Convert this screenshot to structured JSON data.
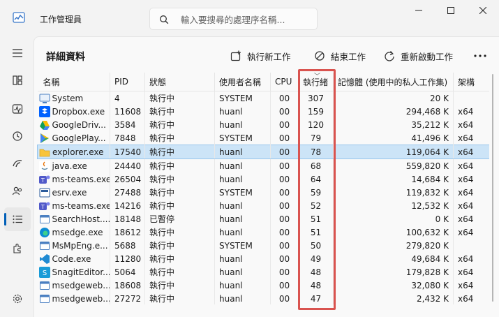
{
  "app": {
    "title": "工作管理員"
  },
  "search": {
    "placeholder": "輸入要搜尋的處理序名稱..."
  },
  "page": {
    "title": "詳細資料"
  },
  "commands": {
    "run_new_task": "執行新工作",
    "end_task": "結束工作",
    "restart": "重新啟動工作"
  },
  "accent_color": "#005fb8",
  "highlight_color": "#d9534f",
  "columns": [
    "名稱",
    "PID",
    "狀態",
    "使用者名稱",
    "CPU",
    "執行緒",
    "記憶體 (使用中的私人工作集)",
    "架構"
  ],
  "sorted_column": "執行緒",
  "nav": [
    "menu-icon",
    "processes-icon",
    "performance-icon",
    "app-history-icon",
    "startup-apps-icon",
    "users-icon",
    "details-icon",
    "services-icon",
    "settings-icon"
  ],
  "rows": [
    {
      "name": "System",
      "pid": "4",
      "status": "執行中",
      "user": "SYSTEM",
      "cpu": "00",
      "threads": "307",
      "memory": "20 K",
      "arch": "",
      "icon": "system-icon",
      "selected": false
    },
    {
      "name": "Dropbox.exe",
      "pid": "11608",
      "status": "執行中",
      "user": "huanl",
      "cpu": "00",
      "threads": "159",
      "memory": "294,468 K",
      "arch": "x64",
      "icon": "dropbox-icon",
      "selected": false
    },
    {
      "name": "GoogleDriv...",
      "pid": "3584",
      "status": "執行中",
      "user": "huanl",
      "cpu": "00",
      "threads": "120",
      "memory": "35,212 K",
      "arch": "x64",
      "icon": "google-drive-icon",
      "selected": false
    },
    {
      "name": "GooglePlay...",
      "pid": "7848",
      "status": "執行中",
      "user": "SYSTEM",
      "cpu": "00",
      "threads": "79",
      "memory": "41,496 K",
      "arch": "x64",
      "icon": "google-play-icon",
      "selected": false
    },
    {
      "name": "explorer.exe",
      "pid": "17540",
      "status": "執行中",
      "user": "huanl",
      "cpu": "00",
      "threads": "78",
      "memory": "119,064 K",
      "arch": "x64",
      "icon": "folder-icon",
      "selected": true
    },
    {
      "name": "java.exe",
      "pid": "24440",
      "status": "執行中",
      "user": "huanl",
      "cpu": "00",
      "threads": "68",
      "memory": "559,820 K",
      "arch": "x64",
      "icon": "java-icon",
      "selected": false
    },
    {
      "name": "ms-teams.exe",
      "pid": "26504",
      "status": "執行中",
      "user": "huanl",
      "cpu": "00",
      "threads": "64",
      "memory": "14,684 K",
      "arch": "x64",
      "icon": "teams-icon",
      "selected": false
    },
    {
      "name": "esrv.exe",
      "pid": "27488",
      "status": "執行中",
      "user": "SYSTEM",
      "cpu": "00",
      "threads": "59",
      "memory": "119,832 K",
      "arch": "x64",
      "icon": "esrv-icon",
      "selected": false
    },
    {
      "name": "ms-teams.exe",
      "pid": "14216",
      "status": "執行中",
      "user": "huanl",
      "cpu": "00",
      "threads": "52",
      "memory": "12,532 K",
      "arch": "x64",
      "icon": "teams-icon",
      "selected": false
    },
    {
      "name": "SearchHost....",
      "pid": "18148",
      "status": "已暫停",
      "user": "huanl",
      "cpu": "00",
      "threads": "51",
      "memory": "0 K",
      "arch": "x64",
      "icon": "app-icon",
      "selected": false
    },
    {
      "name": "msedge.exe",
      "pid": "18612",
      "status": "執行中",
      "user": "huanl",
      "cpu": "00",
      "threads": "51",
      "memory": "100,632 K",
      "arch": "x64",
      "icon": "edge-icon",
      "selected": false
    },
    {
      "name": "MsMpEng.e...",
      "pid": "5688",
      "status": "執行中",
      "user": "SYSTEM",
      "cpu": "00",
      "threads": "50",
      "memory": "279,820 K",
      "arch": "",
      "icon": "app-icon",
      "selected": false
    },
    {
      "name": "Code.exe",
      "pid": "11280",
      "status": "執行中",
      "user": "huanl",
      "cpu": "00",
      "threads": "49",
      "memory": "49,684 K",
      "arch": "x64",
      "icon": "vscode-icon",
      "selected": false
    },
    {
      "name": "SnagitEditor...",
      "pid": "5064",
      "status": "執行中",
      "user": "huanl",
      "cpu": "00",
      "threads": "48",
      "memory": "179,828 K",
      "arch": "x64",
      "icon": "snagit-icon",
      "selected": false
    },
    {
      "name": "msedgeweb...",
      "pid": "18608",
      "status": "執行中",
      "user": "huanl",
      "cpu": "00",
      "threads": "48",
      "memory": "32,080 K",
      "arch": "x64",
      "icon": "app-icon",
      "selected": false
    },
    {
      "name": "msedgeweb...",
      "pid": "27272",
      "status": "執行中",
      "user": "huanl",
      "cpu": "00",
      "threads": "47",
      "memory": "2,432 K",
      "arch": "x64",
      "icon": "app-icon",
      "selected": false
    }
  ]
}
